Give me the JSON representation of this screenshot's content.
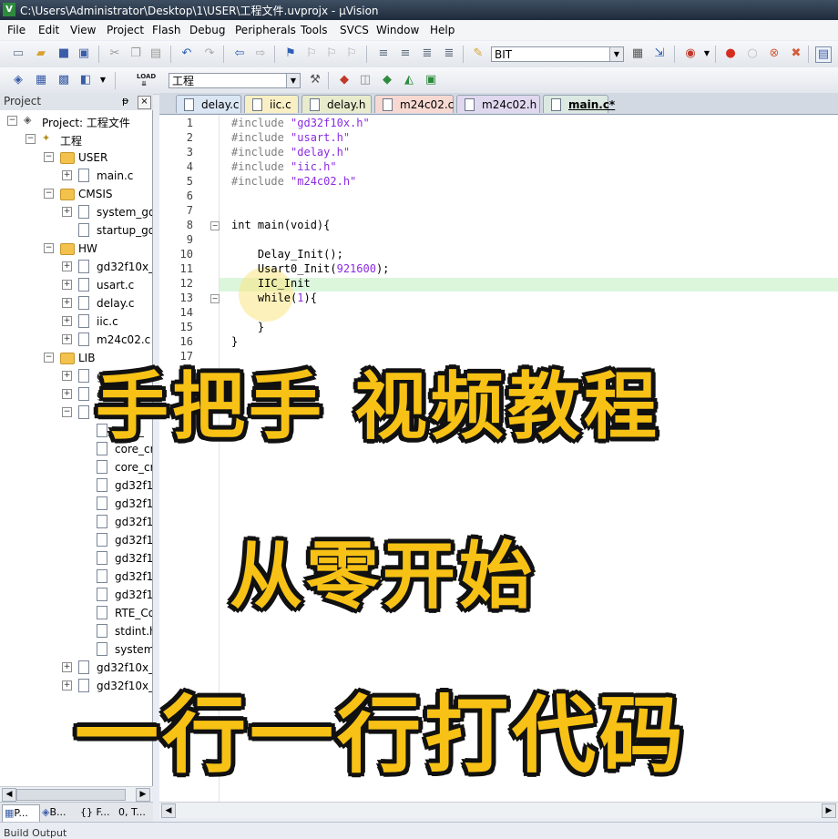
{
  "window": {
    "title": "C:\\Users\\Administrator\\Desktop\\1\\USER\\工程文件.uvprojx - µVision",
    "icon_letter": "V"
  },
  "menu": [
    "File",
    "Edit",
    "View",
    "Project",
    "Flash",
    "Debug",
    "Peripherals",
    "Tools",
    "SVCS",
    "Window",
    "Help"
  ],
  "toolbar1": {
    "find_value": "BIT"
  },
  "toolbar2": {
    "target_value": "工程",
    "load_label": "LOAD"
  },
  "project_panel": {
    "header": "Project",
    "pin": "ᵽ",
    "close": "×",
    "tree": [
      {
        "label": "Project: 工程文件",
        "depth": 0,
        "type": "project",
        "exp": "−"
      },
      {
        "label": "工程",
        "depth": 1,
        "type": "target",
        "exp": "−"
      },
      {
        "label": "USER",
        "depth": 2,
        "type": "folder",
        "exp": "−"
      },
      {
        "label": "main.c",
        "depth": 3,
        "type": "file",
        "exp": "+"
      },
      {
        "label": "CMSIS",
        "depth": 2,
        "type": "folder",
        "exp": "−"
      },
      {
        "label": "system_gd3",
        "depth": 3,
        "type": "file",
        "exp": "+"
      },
      {
        "label": "startup_gd3",
        "depth": 3,
        "type": "file",
        "exp": ""
      },
      {
        "label": "HW",
        "depth": 2,
        "type": "folder",
        "exp": "−"
      },
      {
        "label": "gd32f10x_it",
        "depth": 3,
        "type": "file",
        "exp": "+"
      },
      {
        "label": "usart.c",
        "depth": 3,
        "type": "file",
        "exp": "+"
      },
      {
        "label": "delay.c",
        "depth": 3,
        "type": "file",
        "exp": "+"
      },
      {
        "label": "iic.c",
        "depth": 3,
        "type": "file",
        "exp": "+"
      },
      {
        "label": "m24c02.c",
        "depth": 3,
        "type": "file",
        "exp": "+"
      },
      {
        "label": "LIB",
        "depth": 2,
        "type": "folder",
        "exp": "−"
      },
      {
        "label": "gd32",
        "depth": 3,
        "type": "file",
        "exp": "+"
      },
      {
        "label": "gd3",
        "depth": 3,
        "type": "file",
        "exp": "+"
      },
      {
        "label": "gd32f10",
        "depth": 3,
        "type": "file",
        "exp": "−"
      },
      {
        "label": "core_",
        "depth": 4,
        "type": "file",
        "exp": ""
      },
      {
        "label": "core_cr",
        "depth": 4,
        "type": "file",
        "exp": ""
      },
      {
        "label": "core_cr",
        "depth": 4,
        "type": "file",
        "exp": ""
      },
      {
        "label": "gd32f10",
        "depth": 4,
        "type": "file",
        "exp": ""
      },
      {
        "label": "gd32f10",
        "depth": 4,
        "type": "file",
        "exp": ""
      },
      {
        "label": "gd32f10",
        "depth": 4,
        "type": "file",
        "exp": ""
      },
      {
        "label": "gd32f10",
        "depth": 4,
        "type": "filekey",
        "exp": ""
      },
      {
        "label": "gd32f10",
        "depth": 4,
        "type": "file",
        "exp": ""
      },
      {
        "label": "gd32f10",
        "depth": 4,
        "type": "file",
        "exp": ""
      },
      {
        "label": "gd32f10",
        "depth": 4,
        "type": "file",
        "exp": ""
      },
      {
        "label": "RTE_Co",
        "depth": 4,
        "type": "file",
        "exp": ""
      },
      {
        "label": "stdint.h",
        "depth": 4,
        "type": "file",
        "exp": ""
      },
      {
        "label": "system_",
        "depth": 4,
        "type": "file",
        "exp": ""
      },
      {
        "label": "gd32f10x_u",
        "depth": 3,
        "type": "file",
        "exp": "+"
      },
      {
        "label": "gd32f10x_d",
        "depth": 3,
        "type": "file",
        "exp": "+"
      }
    ],
    "bottom_tabs": [
      "P...",
      "B...",
      "{} F...",
      "0, T..."
    ]
  },
  "build_output_label": "Build Output",
  "editor_tabs": [
    {
      "label": "delay.c",
      "color": "#dbe6f5"
    },
    {
      "label": "iic.c",
      "color": "#f8f0c4"
    },
    {
      "label": "delay.h",
      "color": "#e8eccc"
    },
    {
      "label": "m24c02.c",
      "color": "#f7d9d2"
    },
    {
      "label": "m24c02.h",
      "color": "#e0d8ef"
    },
    {
      "label": "main.c*",
      "color": "#dbe9e2",
      "active": true
    }
  ],
  "code_lines": [
    "#include \"gd32f10x.h\"",
    "#include \"usart.h\"",
    "#include \"delay.h\"",
    "#include \"iic.h\"",
    "#include \"m24c02.h\"",
    "",
    "",
    "int main(void){",
    "",
    "    Delay_Init();",
    "    Usart0_Init(921600);",
    "    IIC_Init",
    "    while(1){",
    "",
    "    }",
    "}",
    ""
  ],
  "overlay": {
    "line1": "手把手 视频教程",
    "line2": "从零开始",
    "line3": "一行一行打代码"
  }
}
